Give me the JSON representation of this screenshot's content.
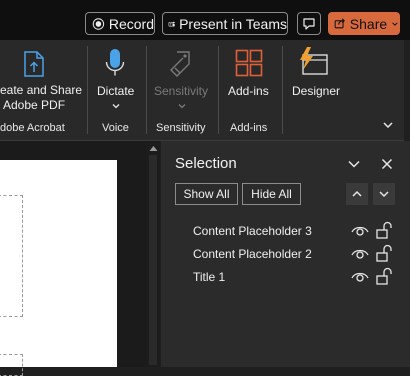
{
  "titlebar": {
    "record_label": "Record",
    "teams_label": "Present in Teams",
    "share_label": "Share"
  },
  "ribbon": {
    "acrobat_button_label_line1": "eate and Share",
    "acrobat_button_label_line2": "Adobe PDF",
    "acrobat_group_label": "dobe Acrobat",
    "dictate_label": "Dictate",
    "voice_group_label": "Voice",
    "sensitivity_button_label": "Sensitivity",
    "sensitivity_group_label": "Sensitivity",
    "addins_button_label": "Add-ins",
    "addins_group_label": "Add-ins",
    "designer_label": "Designer"
  },
  "selection_pane": {
    "title": "Selection",
    "show_all_label": "Show All",
    "hide_all_label": "Hide All",
    "items": [
      {
        "label": "Content Placeholder 3"
      },
      {
        "label": "Content Placeholder 2"
      },
      {
        "label": "Title 1"
      }
    ]
  },
  "colors": {
    "share_accent": "#d7693d",
    "designer_bolt": "#f0a030",
    "dictate_mic": "#4aa3e8",
    "addins_grid": "#e0603a"
  }
}
